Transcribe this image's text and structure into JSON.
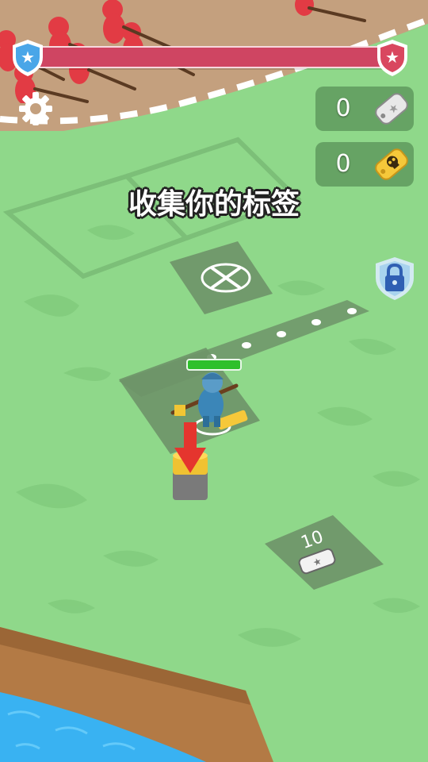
{
  "hud": {
    "player_health_fraction": 1.0,
    "enemy_health_fraction": 1.0,
    "silver_tags": {
      "value": "0",
      "icon": "silver-dogtag-icon"
    },
    "gold_tags": {
      "value": "0",
      "icon": "gold-skull-tag-icon"
    },
    "settings_icon": "gear-icon"
  },
  "instruction": {
    "text": "收集你的标签"
  },
  "map": {
    "lock_icon": "lock-shield-icon",
    "upgrade_pad": {
      "cost": "10",
      "cost_icon": "silver-dogtag-icon"
    },
    "weapon_pad": {
      "icon": "crossed-rifles-icon"
    }
  },
  "colors": {
    "grass": "#8fd88a",
    "dirt": "#c4a07e",
    "health_red": "#cf4562",
    "team_blue": "#4aa6e8",
    "enemy_red": "#e23b44",
    "water": "#39b2f2"
  }
}
